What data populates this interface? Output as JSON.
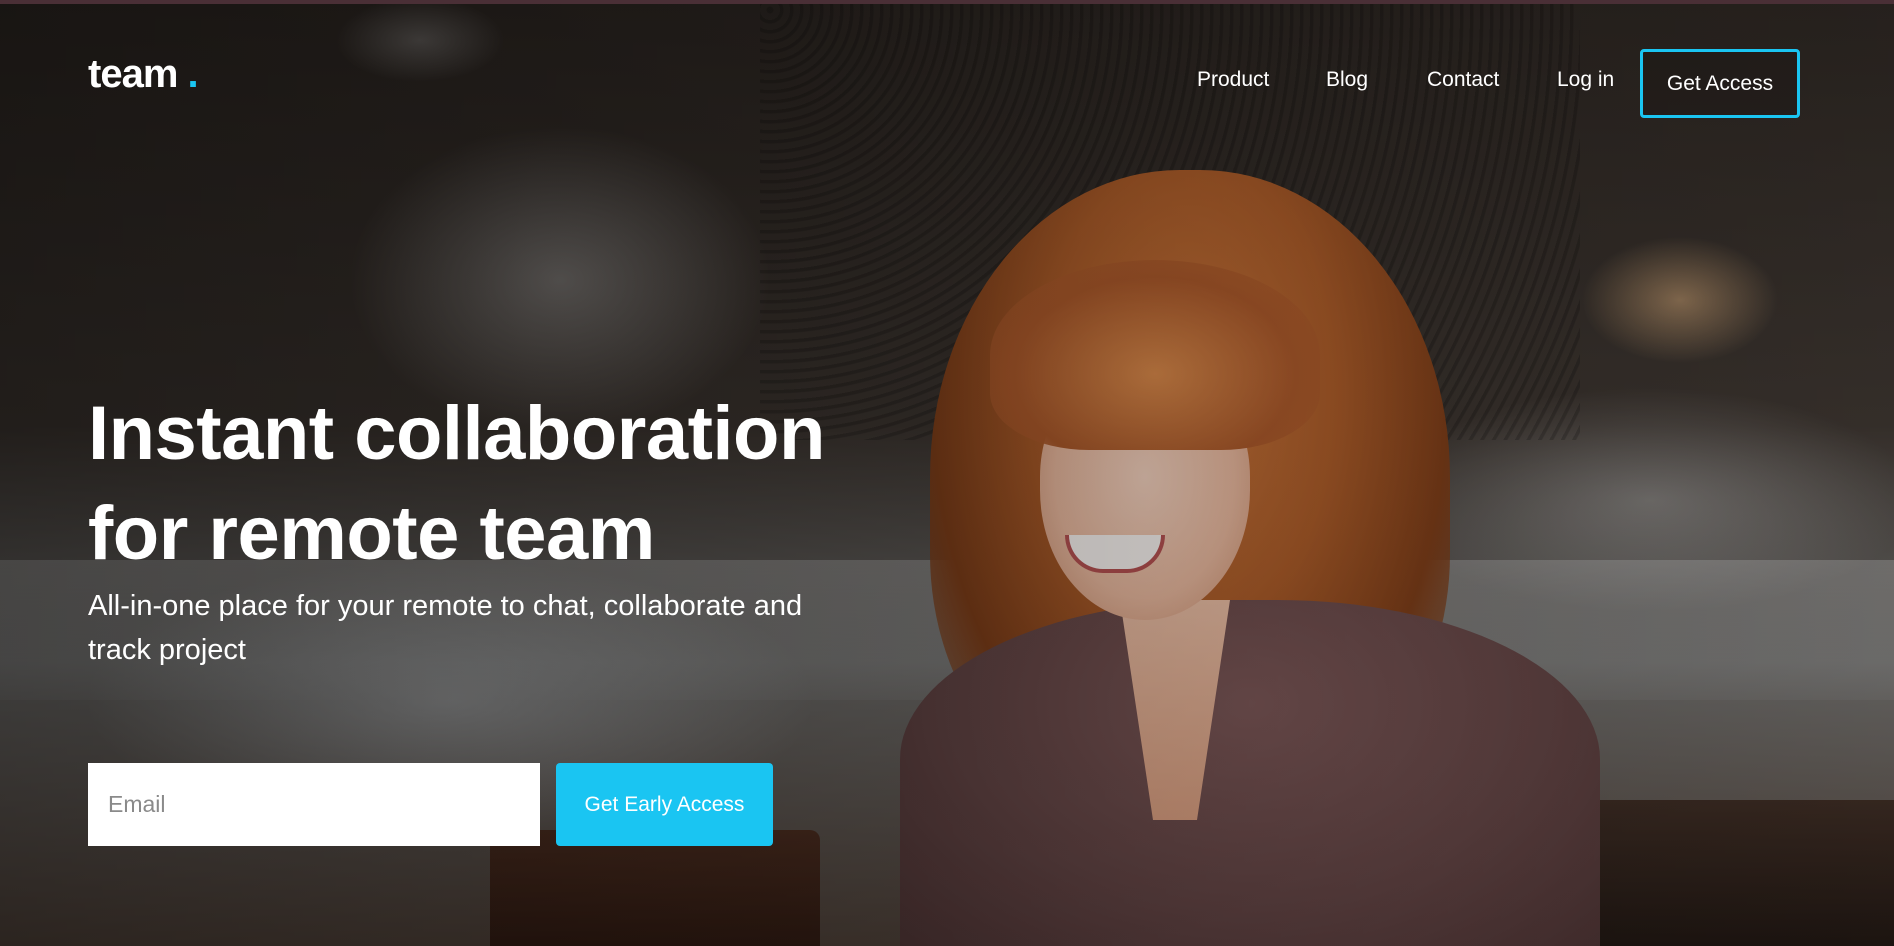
{
  "brand": {
    "name": "team",
    "dot": ".",
    "accent_color": "#1ac5f2"
  },
  "nav": {
    "items": [
      {
        "label": "Product"
      },
      {
        "label": "Blog"
      },
      {
        "label": "Contact"
      },
      {
        "label": "Log in"
      }
    ],
    "cta_label": "Get Access"
  },
  "hero": {
    "headline_line1": "Instant collaboration",
    "headline_line2": "for remote team",
    "subheadline": "All-in-one place for your remote to chat, collaborate and track project",
    "email_placeholder": "Email",
    "email_value": "",
    "submit_label": "Get Early Access",
    "background_image": "woman-smiling-cafe-photo"
  }
}
